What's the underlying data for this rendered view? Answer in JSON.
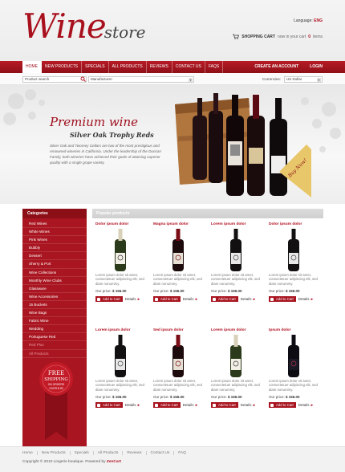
{
  "header": {
    "logo_main": "Wine",
    "logo_sub": "store",
    "language_label": "Language:",
    "language_value": "ENG",
    "cart_label": "SHOPPING CART",
    "cart_text_before": "now in your cart",
    "cart_count": "0",
    "cart_text_after": "items"
  },
  "nav": {
    "items": [
      "HOME",
      "NEW PRODUCTS",
      "SPECIALS",
      "ALL PRODUCTS",
      "REVIEWS",
      "CONTACT US",
      "FAQS"
    ],
    "create_account": "CREATE AN ACCOUNT",
    "login": "LOGIN"
  },
  "search": {
    "placeholder": "Product search",
    "manufacturer_label": "Manufacturer:",
    "currency_label": "Currencies:",
    "currency_value": "US Dollar"
  },
  "banner": {
    "title": "Premium wine",
    "subtitle": "Silver Oak Trophy Reds",
    "text": "Silver Oak and Twomey Cellars are two of the most prestigious and renowned wineries in California. Under the leadership of the Duncan Family, both wineries have achieved their goals of attaining superior quality with a single grape variety.",
    "buy_now": "Buy Now!"
  },
  "sidebar": {
    "heading": "Categories",
    "items": [
      "Red Wines",
      "White Wines",
      "Pink Wines",
      "Bubbly",
      "Dessert",
      "Sherry & Port",
      "Wine Collections",
      "Monthly Wine Clubs",
      "Glassware",
      "Wine Accessories",
      "15 Buckets",
      "Wine Bags",
      "Fabric Wine",
      "Wedding",
      "Portuguese Red",
      "Red Plus",
      "All Products"
    ],
    "seal_line1": "FREE",
    "seal_line2": "SHIPPING",
    "seal_line3": "ON ORDERS",
    "seal_line4": "OVER $ 99"
  },
  "products": {
    "heading": "Popular products",
    "price_label": "Our price:",
    "add_label": "Add to Cart",
    "details_label": "Details",
    "items": [
      {
        "name": "Dolor ipsum dolor",
        "desc": "Lorem ipsum dolor sit amet, consectetuer adipiscing elit, sed diam nonummy.",
        "price": "$ 156.00",
        "bottle": "white"
      },
      {
        "name": "Magna ipsum dolor",
        "desc": "Lorem ipsum dolor sit amet, consectetuer adipiscing elit, sed diam nonummy.",
        "price": "$ 156.00",
        "bottle": "red"
      },
      {
        "name": "Lorem ipsum dolor",
        "desc": "Lorem ipsum dolor sit amet, consectetuer adipiscing elit, sed diam nonummy.",
        "price": "$ 156.00",
        "bottle": "dark"
      },
      {
        "name": "Dolor ipsum dolor",
        "desc": "Lorem ipsum dolor sit amet, consectetuer adipiscing elit, sed diam nonummy.",
        "price": "$ 156.00",
        "bottle": "dark"
      },
      {
        "name": "Lorem ipsum dolor",
        "desc": "Lorem ipsum dolor sit amet, consectetuer adipiscing elit, sed diam nonummy.",
        "price": "$ 156.00",
        "bottle": "dark"
      },
      {
        "name": "Sed ipsum dolor",
        "desc": "Lorem ipsum dolor sit amet, consectetuer adipiscing elit, sed diam nonummy.",
        "price": "$ 156.00",
        "bottle": "red"
      },
      {
        "name": "Lorem ipsum dolor",
        "desc": "Lorem ipsum dolor sit amet, consectetuer adipiscing elit, sed diam nonummy.",
        "price": "$ 156.00",
        "bottle": "white"
      },
      {
        "name": "Ipsum dolor",
        "desc": "Lorem ipsum dolor sit amet, consectetuer adipiscing elit, sed diam nonummy.",
        "price": "$ 156.00",
        "bottle": "black"
      }
    ]
  },
  "footer": {
    "links": [
      "Home",
      "New Products",
      "Specials",
      "All Products",
      "Reviews",
      "Contact Us",
      "FAQ"
    ],
    "copyright": "Copyright © 2010 Lingerie boutique. Powered by",
    "powered": "ZenCart"
  },
  "colors": {
    "brand": "#a8101d",
    "nav": "#a3141f",
    "sidebar": "#a91520"
  }
}
